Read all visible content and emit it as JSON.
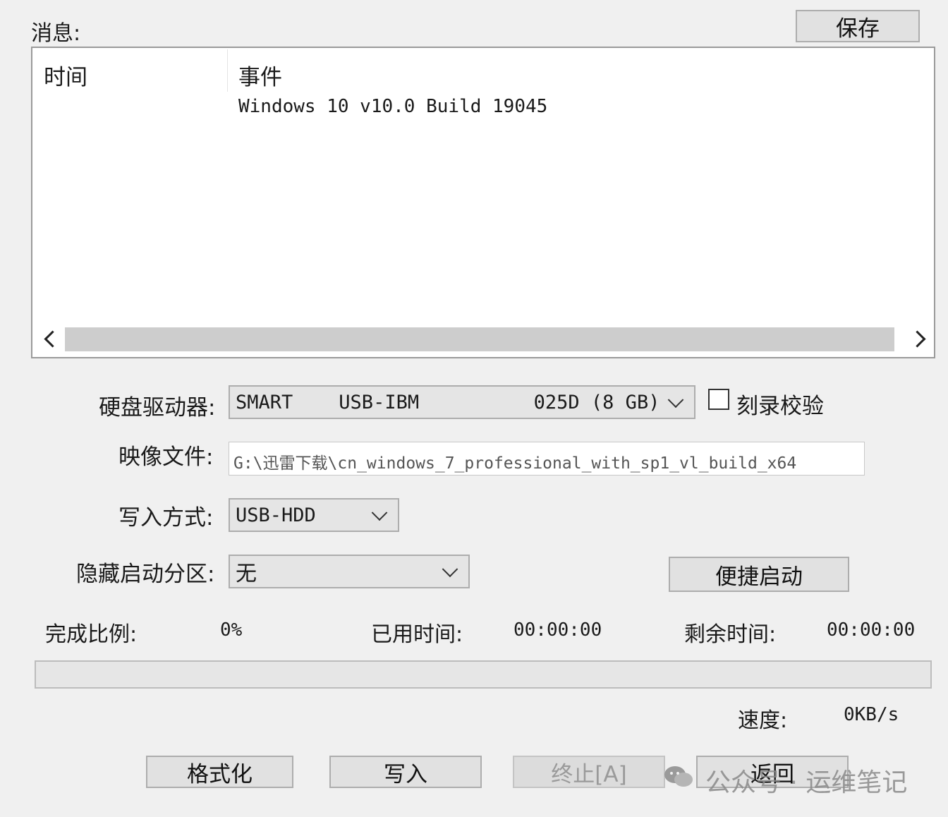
{
  "messages_label": "消息:",
  "save_button": "保存",
  "table": {
    "columns": [
      "时间",
      "事件"
    ],
    "rows": [
      {
        "time": "",
        "event": "Windows 10 v10.0 Build 19045"
      }
    ]
  },
  "form": {
    "drive_label": "硬盘驱动器:",
    "drive_value": "SMART    USB-IBM          025D (8 GB)",
    "verify_label": "刻录校验",
    "verify_checked": false,
    "image_label": "映像文件:",
    "image_value": "G:\\迅雷下载\\cn_windows_7_professional_with_sp1_vl_build_x64",
    "write_mode_label": "写入方式:",
    "write_mode_value": "USB-HDD",
    "hidden_partition_label": "隐藏启动分区:",
    "hidden_partition_value": "无",
    "quick_start_button": "便捷启动"
  },
  "status": {
    "progress_label": "完成比例:",
    "progress_value": "0%",
    "progress_fraction": 0,
    "elapsed_label": "已用时间:",
    "elapsed_value": "00:00:00",
    "remaining_label": "剩余时间:",
    "remaining_value": "00:00:00",
    "speed_label": "速度:",
    "speed_value": "0KB/s"
  },
  "buttons": {
    "format": "格式化",
    "write": "写入",
    "stop": "终止[A]",
    "back": "返回"
  },
  "watermark": "公众号 · 运维笔记"
}
